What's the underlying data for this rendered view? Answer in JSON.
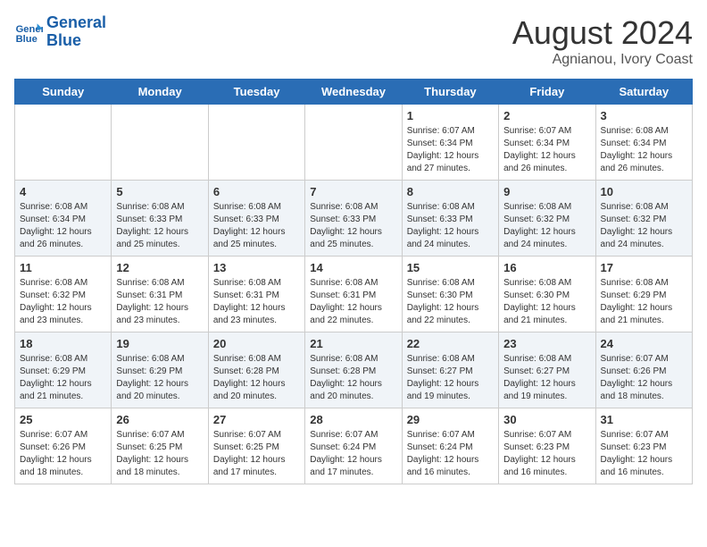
{
  "logo": {
    "line1": "General",
    "line2": "Blue"
  },
  "title": "August 2024",
  "subtitle": "Agnianou, Ivory Coast",
  "days_of_week": [
    "Sunday",
    "Monday",
    "Tuesday",
    "Wednesday",
    "Thursday",
    "Friday",
    "Saturday"
  ],
  "weeks": [
    [
      {
        "day": "",
        "info": ""
      },
      {
        "day": "",
        "info": ""
      },
      {
        "day": "",
        "info": ""
      },
      {
        "day": "",
        "info": ""
      },
      {
        "day": "1",
        "info": "Sunrise: 6:07 AM\nSunset: 6:34 PM\nDaylight: 12 hours\nand 27 minutes."
      },
      {
        "day": "2",
        "info": "Sunrise: 6:07 AM\nSunset: 6:34 PM\nDaylight: 12 hours\nand 26 minutes."
      },
      {
        "day": "3",
        "info": "Sunrise: 6:08 AM\nSunset: 6:34 PM\nDaylight: 12 hours\nand 26 minutes."
      }
    ],
    [
      {
        "day": "4",
        "info": "Sunrise: 6:08 AM\nSunset: 6:34 PM\nDaylight: 12 hours\nand 26 minutes."
      },
      {
        "day": "5",
        "info": "Sunrise: 6:08 AM\nSunset: 6:33 PM\nDaylight: 12 hours\nand 25 minutes."
      },
      {
        "day": "6",
        "info": "Sunrise: 6:08 AM\nSunset: 6:33 PM\nDaylight: 12 hours\nand 25 minutes."
      },
      {
        "day": "7",
        "info": "Sunrise: 6:08 AM\nSunset: 6:33 PM\nDaylight: 12 hours\nand 25 minutes."
      },
      {
        "day": "8",
        "info": "Sunrise: 6:08 AM\nSunset: 6:33 PM\nDaylight: 12 hours\nand 24 minutes."
      },
      {
        "day": "9",
        "info": "Sunrise: 6:08 AM\nSunset: 6:32 PM\nDaylight: 12 hours\nand 24 minutes."
      },
      {
        "day": "10",
        "info": "Sunrise: 6:08 AM\nSunset: 6:32 PM\nDaylight: 12 hours\nand 24 minutes."
      }
    ],
    [
      {
        "day": "11",
        "info": "Sunrise: 6:08 AM\nSunset: 6:32 PM\nDaylight: 12 hours\nand 23 minutes."
      },
      {
        "day": "12",
        "info": "Sunrise: 6:08 AM\nSunset: 6:31 PM\nDaylight: 12 hours\nand 23 minutes."
      },
      {
        "day": "13",
        "info": "Sunrise: 6:08 AM\nSunset: 6:31 PM\nDaylight: 12 hours\nand 23 minutes."
      },
      {
        "day": "14",
        "info": "Sunrise: 6:08 AM\nSunset: 6:31 PM\nDaylight: 12 hours\nand 22 minutes."
      },
      {
        "day": "15",
        "info": "Sunrise: 6:08 AM\nSunset: 6:30 PM\nDaylight: 12 hours\nand 22 minutes."
      },
      {
        "day": "16",
        "info": "Sunrise: 6:08 AM\nSunset: 6:30 PM\nDaylight: 12 hours\nand 21 minutes."
      },
      {
        "day": "17",
        "info": "Sunrise: 6:08 AM\nSunset: 6:29 PM\nDaylight: 12 hours\nand 21 minutes."
      }
    ],
    [
      {
        "day": "18",
        "info": "Sunrise: 6:08 AM\nSunset: 6:29 PM\nDaylight: 12 hours\nand 21 minutes."
      },
      {
        "day": "19",
        "info": "Sunrise: 6:08 AM\nSunset: 6:29 PM\nDaylight: 12 hours\nand 20 minutes."
      },
      {
        "day": "20",
        "info": "Sunrise: 6:08 AM\nSunset: 6:28 PM\nDaylight: 12 hours\nand 20 minutes."
      },
      {
        "day": "21",
        "info": "Sunrise: 6:08 AM\nSunset: 6:28 PM\nDaylight: 12 hours\nand 20 minutes."
      },
      {
        "day": "22",
        "info": "Sunrise: 6:08 AM\nSunset: 6:27 PM\nDaylight: 12 hours\nand 19 minutes."
      },
      {
        "day": "23",
        "info": "Sunrise: 6:08 AM\nSunset: 6:27 PM\nDaylight: 12 hours\nand 19 minutes."
      },
      {
        "day": "24",
        "info": "Sunrise: 6:07 AM\nSunset: 6:26 PM\nDaylight: 12 hours\nand 18 minutes."
      }
    ],
    [
      {
        "day": "25",
        "info": "Sunrise: 6:07 AM\nSunset: 6:26 PM\nDaylight: 12 hours\nand 18 minutes."
      },
      {
        "day": "26",
        "info": "Sunrise: 6:07 AM\nSunset: 6:25 PM\nDaylight: 12 hours\nand 18 minutes."
      },
      {
        "day": "27",
        "info": "Sunrise: 6:07 AM\nSunset: 6:25 PM\nDaylight: 12 hours\nand 17 minutes."
      },
      {
        "day": "28",
        "info": "Sunrise: 6:07 AM\nSunset: 6:24 PM\nDaylight: 12 hours\nand 17 minutes."
      },
      {
        "day": "29",
        "info": "Sunrise: 6:07 AM\nSunset: 6:24 PM\nDaylight: 12 hours\nand 16 minutes."
      },
      {
        "day": "30",
        "info": "Sunrise: 6:07 AM\nSunset: 6:23 PM\nDaylight: 12 hours\nand 16 minutes."
      },
      {
        "day": "31",
        "info": "Sunrise: 6:07 AM\nSunset: 6:23 PM\nDaylight: 12 hours\nand 16 minutes."
      }
    ]
  ]
}
